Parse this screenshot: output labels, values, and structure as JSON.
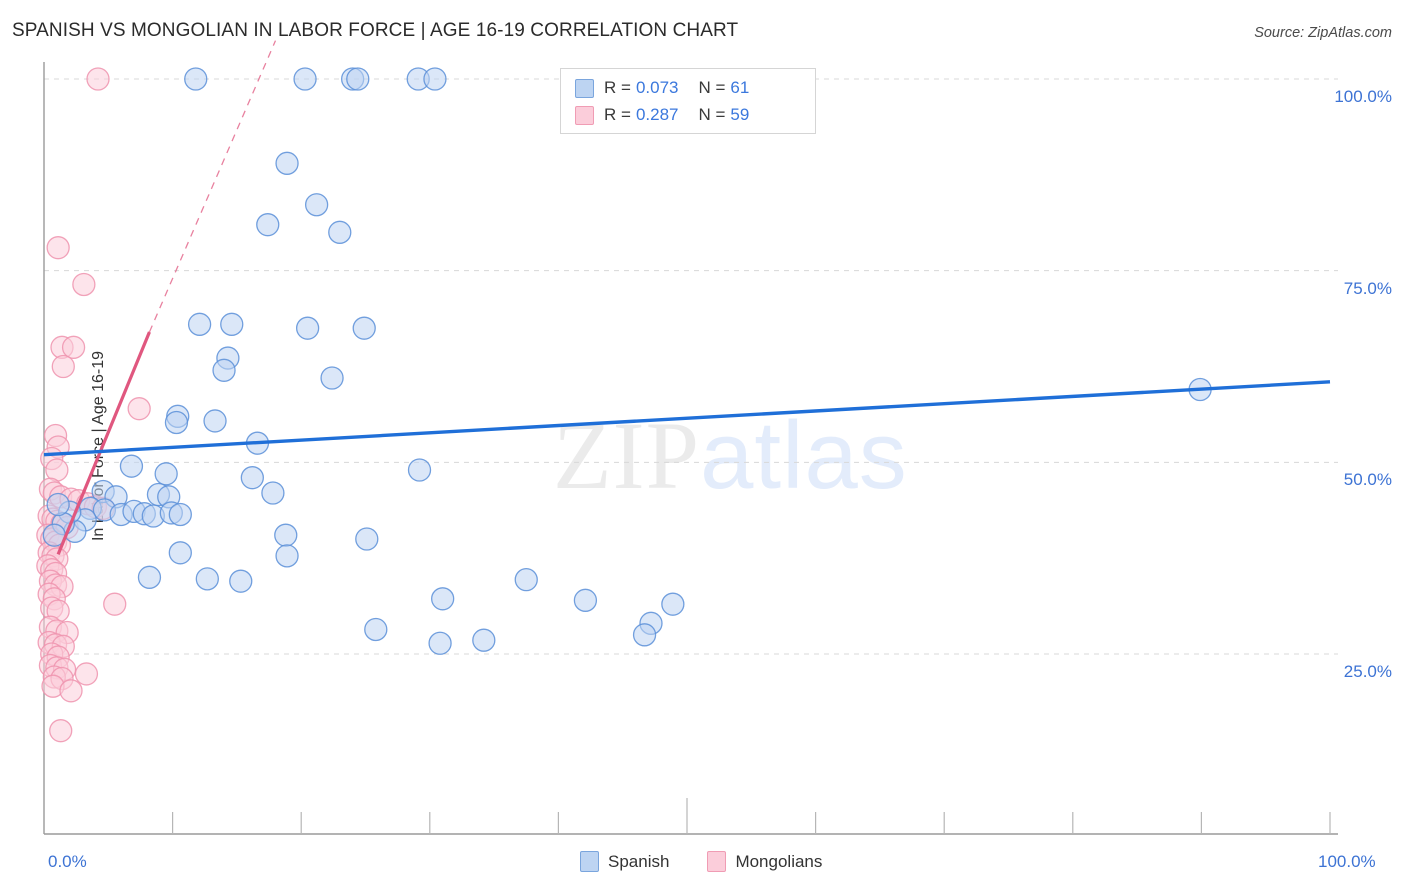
{
  "header": {
    "title": "SPANISH VS MONGOLIAN IN LABOR FORCE | AGE 16-19 CORRELATION CHART",
    "source": "Source: ZipAtlas.com"
  },
  "legend_box": {
    "rows": [
      {
        "series": "Spanish",
        "color": "#bdd4f2",
        "r_label": "R =",
        "r_value": "0.073",
        "n_label": "N =",
        "n_value": "61"
      },
      {
        "series": "Mongolians",
        "color": "#fbcdda",
        "r_label": "R =",
        "r_value": "0.287",
        "n_label": "N =",
        "n_value": "59"
      }
    ]
  },
  "bottom_legend": [
    {
      "label": "Spanish",
      "color": "#bdd4f2"
    },
    {
      "label": "Mongolians",
      "color": "#fbcdda"
    }
  ],
  "watermark": {
    "part1": "ZIP",
    "part2": "atlas"
  },
  "axes": {
    "y_ticks": [
      "100.0%",
      "75.0%",
      "50.0%",
      "25.0%"
    ],
    "x_ticks": [
      "0.0%",
      "100.0%"
    ]
  },
  "chart_data": {
    "type": "scatter",
    "title": "SPANISH VS MONGOLIAN IN LABOR FORCE | AGE 16-19 CORRELATION CHART",
    "xlabel": "",
    "ylabel": "In Labor Force | Age 16-19",
    "xlim": [
      0,
      100
    ],
    "ylim": [
      0,
      104
    ],
    "grid": true,
    "x_tick_values": [
      0,
      100
    ],
    "y_tick_values": [
      25,
      50,
      75,
      100
    ],
    "legend_position": "bottom-center",
    "series": [
      {
        "name": "Spanish",
        "color": "#bdd4f2",
        "edge_color": "#5b8fd8",
        "r": 0.073,
        "n": 61,
        "trendline": {
          "style": "solid",
          "color": "#1f6fd8",
          "x0": 0,
          "y0": 51.0,
          "x1": 100,
          "y1": 60.5
        },
        "points": [
          [
            11.8,
            100.0
          ],
          [
            20.3,
            100.0
          ],
          [
            24.0,
            100.0
          ],
          [
            24.4,
            100.0
          ],
          [
            29.1,
            100.0
          ],
          [
            30.4,
            100.0
          ],
          [
            18.9,
            89.0
          ],
          [
            21.2,
            83.6
          ],
          [
            17.4,
            81.0
          ],
          [
            23.0,
            80.0
          ],
          [
            12.1,
            68.0
          ],
          [
            14.6,
            68.0
          ],
          [
            20.5,
            67.5
          ],
          [
            24.9,
            67.5
          ],
          [
            14.3,
            63.6
          ],
          [
            14.0,
            62.0
          ],
          [
            22.4,
            61.0
          ],
          [
            89.9,
            59.5
          ],
          [
            10.4,
            56.0
          ],
          [
            10.3,
            55.2
          ],
          [
            13.3,
            55.4
          ],
          [
            16.6,
            52.5
          ],
          [
            6.8,
            49.5
          ],
          [
            9.5,
            48.5
          ],
          [
            16.2,
            48.0
          ],
          [
            29.2,
            49.0
          ],
          [
            17.8,
            46.0
          ],
          [
            4.6,
            46.2
          ],
          [
            5.6,
            45.5
          ],
          [
            8.9,
            45.8
          ],
          [
            9.7,
            45.5
          ],
          [
            3.6,
            44.0
          ],
          [
            4.7,
            43.8
          ],
          [
            6.0,
            43.2
          ],
          [
            7.0,
            43.6
          ],
          [
            7.8,
            43.3
          ],
          [
            8.5,
            43.0
          ],
          [
            9.9,
            43.4
          ],
          [
            10.6,
            43.2
          ],
          [
            18.8,
            40.5
          ],
          [
            25.1,
            40.0
          ],
          [
            10.6,
            38.2
          ],
          [
            18.9,
            37.8
          ],
          [
            8.2,
            35.0
          ],
          [
            12.7,
            34.8
          ],
          [
            15.3,
            34.5
          ],
          [
            37.5,
            34.7
          ],
          [
            31.0,
            32.2
          ],
          [
            42.1,
            32.0
          ],
          [
            48.9,
            31.5
          ],
          [
            25.8,
            28.2
          ],
          [
            47.2,
            29.0
          ],
          [
            30.8,
            26.4
          ],
          [
            34.2,
            26.8
          ],
          [
            46.7,
            27.5
          ],
          [
            3.2,
            42.5
          ],
          [
            2.4,
            41.0
          ],
          [
            2.0,
            43.5
          ],
          [
            1.5,
            42.0
          ],
          [
            1.1,
            44.5
          ],
          [
            0.8,
            40.5
          ]
        ]
      },
      {
        "name": "Mongolians",
        "color": "#fbcdda",
        "edge_color": "#ef93ae",
        "r": 0.287,
        "n": 59,
        "trendline": {
          "style": "solid-with-dashed-extension",
          "color": "#e0577f",
          "x0": 1.1,
          "y0": 38.0,
          "x1": 8.2,
          "y1": 67.0,
          "dash_x1": 18.0,
          "dash_y1": 105.0
        },
        "points": [
          [
            4.2,
            100.0
          ],
          [
            1.1,
            78.0
          ],
          [
            3.1,
            73.2
          ],
          [
            1.4,
            65.0
          ],
          [
            2.3,
            65.0
          ],
          [
            1.5,
            62.5
          ],
          [
            7.4,
            57.0
          ],
          [
            0.9,
            53.5
          ],
          [
            1.1,
            52.0
          ],
          [
            0.6,
            50.5
          ],
          [
            1.0,
            49.0
          ],
          [
            0.5,
            46.5
          ],
          [
            0.8,
            46.0
          ],
          [
            1.3,
            45.5
          ],
          [
            2.1,
            45.2
          ],
          [
            2.7,
            45.0
          ],
          [
            3.4,
            44.6
          ],
          [
            4.0,
            44.2
          ],
          [
            4.6,
            44.0
          ],
          [
            0.4,
            43.0
          ],
          [
            0.7,
            42.6
          ],
          [
            1.0,
            42.3
          ],
          [
            1.4,
            42.0
          ],
          [
            1.8,
            41.5
          ],
          [
            0.3,
            40.5
          ],
          [
            0.6,
            40.0
          ],
          [
            0.9,
            39.6
          ],
          [
            1.2,
            39.2
          ],
          [
            0.4,
            38.2
          ],
          [
            0.7,
            37.8
          ],
          [
            1.0,
            37.4
          ],
          [
            0.3,
            36.5
          ],
          [
            0.6,
            36.0
          ],
          [
            0.9,
            35.5
          ],
          [
            0.5,
            34.5
          ],
          [
            0.9,
            34.0
          ],
          [
            1.4,
            33.8
          ],
          [
            0.4,
            32.8
          ],
          [
            0.8,
            32.2
          ],
          [
            0.6,
            31.0
          ],
          [
            1.1,
            30.6
          ],
          [
            5.5,
            31.5
          ],
          [
            0.5,
            28.5
          ],
          [
            1.0,
            28.0
          ],
          [
            1.8,
            27.8
          ],
          [
            0.4,
            26.5
          ],
          [
            0.9,
            26.2
          ],
          [
            1.5,
            26.0
          ],
          [
            0.6,
            25.0
          ],
          [
            1.1,
            24.6
          ],
          [
            0.5,
            23.5
          ],
          [
            1.0,
            23.2
          ],
          [
            1.6,
            23.0
          ],
          [
            0.8,
            22.0
          ],
          [
            1.4,
            21.8
          ],
          [
            3.3,
            22.4
          ],
          [
            0.7,
            20.8
          ],
          [
            2.1,
            20.2
          ],
          [
            1.3,
            15.0
          ]
        ]
      }
    ]
  }
}
